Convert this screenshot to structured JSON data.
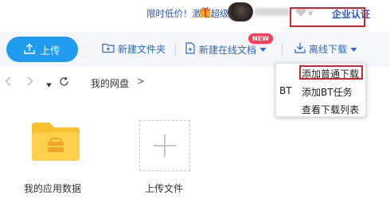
{
  "header": {
    "promo_text": "限时低价！激活超级会员",
    "enterprise_label": "企业认证",
    "gift_icon": "gift-icon",
    "vip_icon": "heart-vip-icon"
  },
  "toolbar": {
    "upload_label": "上传",
    "new_folder_label": "新建文件夹",
    "new_online_doc_label": "新建在线文档",
    "new_badge": "NEW",
    "offline_download_label": "离线下载"
  },
  "dropdown": {
    "items": [
      {
        "label": "添加普通下载",
        "prefix": ""
      },
      {
        "label": "添加BT任务",
        "prefix": "BT"
      },
      {
        "label": "查看下载列表",
        "prefix": ""
      }
    ]
  },
  "nav": {
    "breadcrumb": "我的网盘",
    "separator": ">"
  },
  "files": [
    {
      "name": "我的应用数据",
      "type": "folder"
    },
    {
      "name": "上传文件",
      "type": "upload"
    }
  ],
  "colors": {
    "accent": "#1f9bf0",
    "link": "#2c6cc6",
    "highlight": "#d0262d",
    "folder": "#fcd04a"
  }
}
